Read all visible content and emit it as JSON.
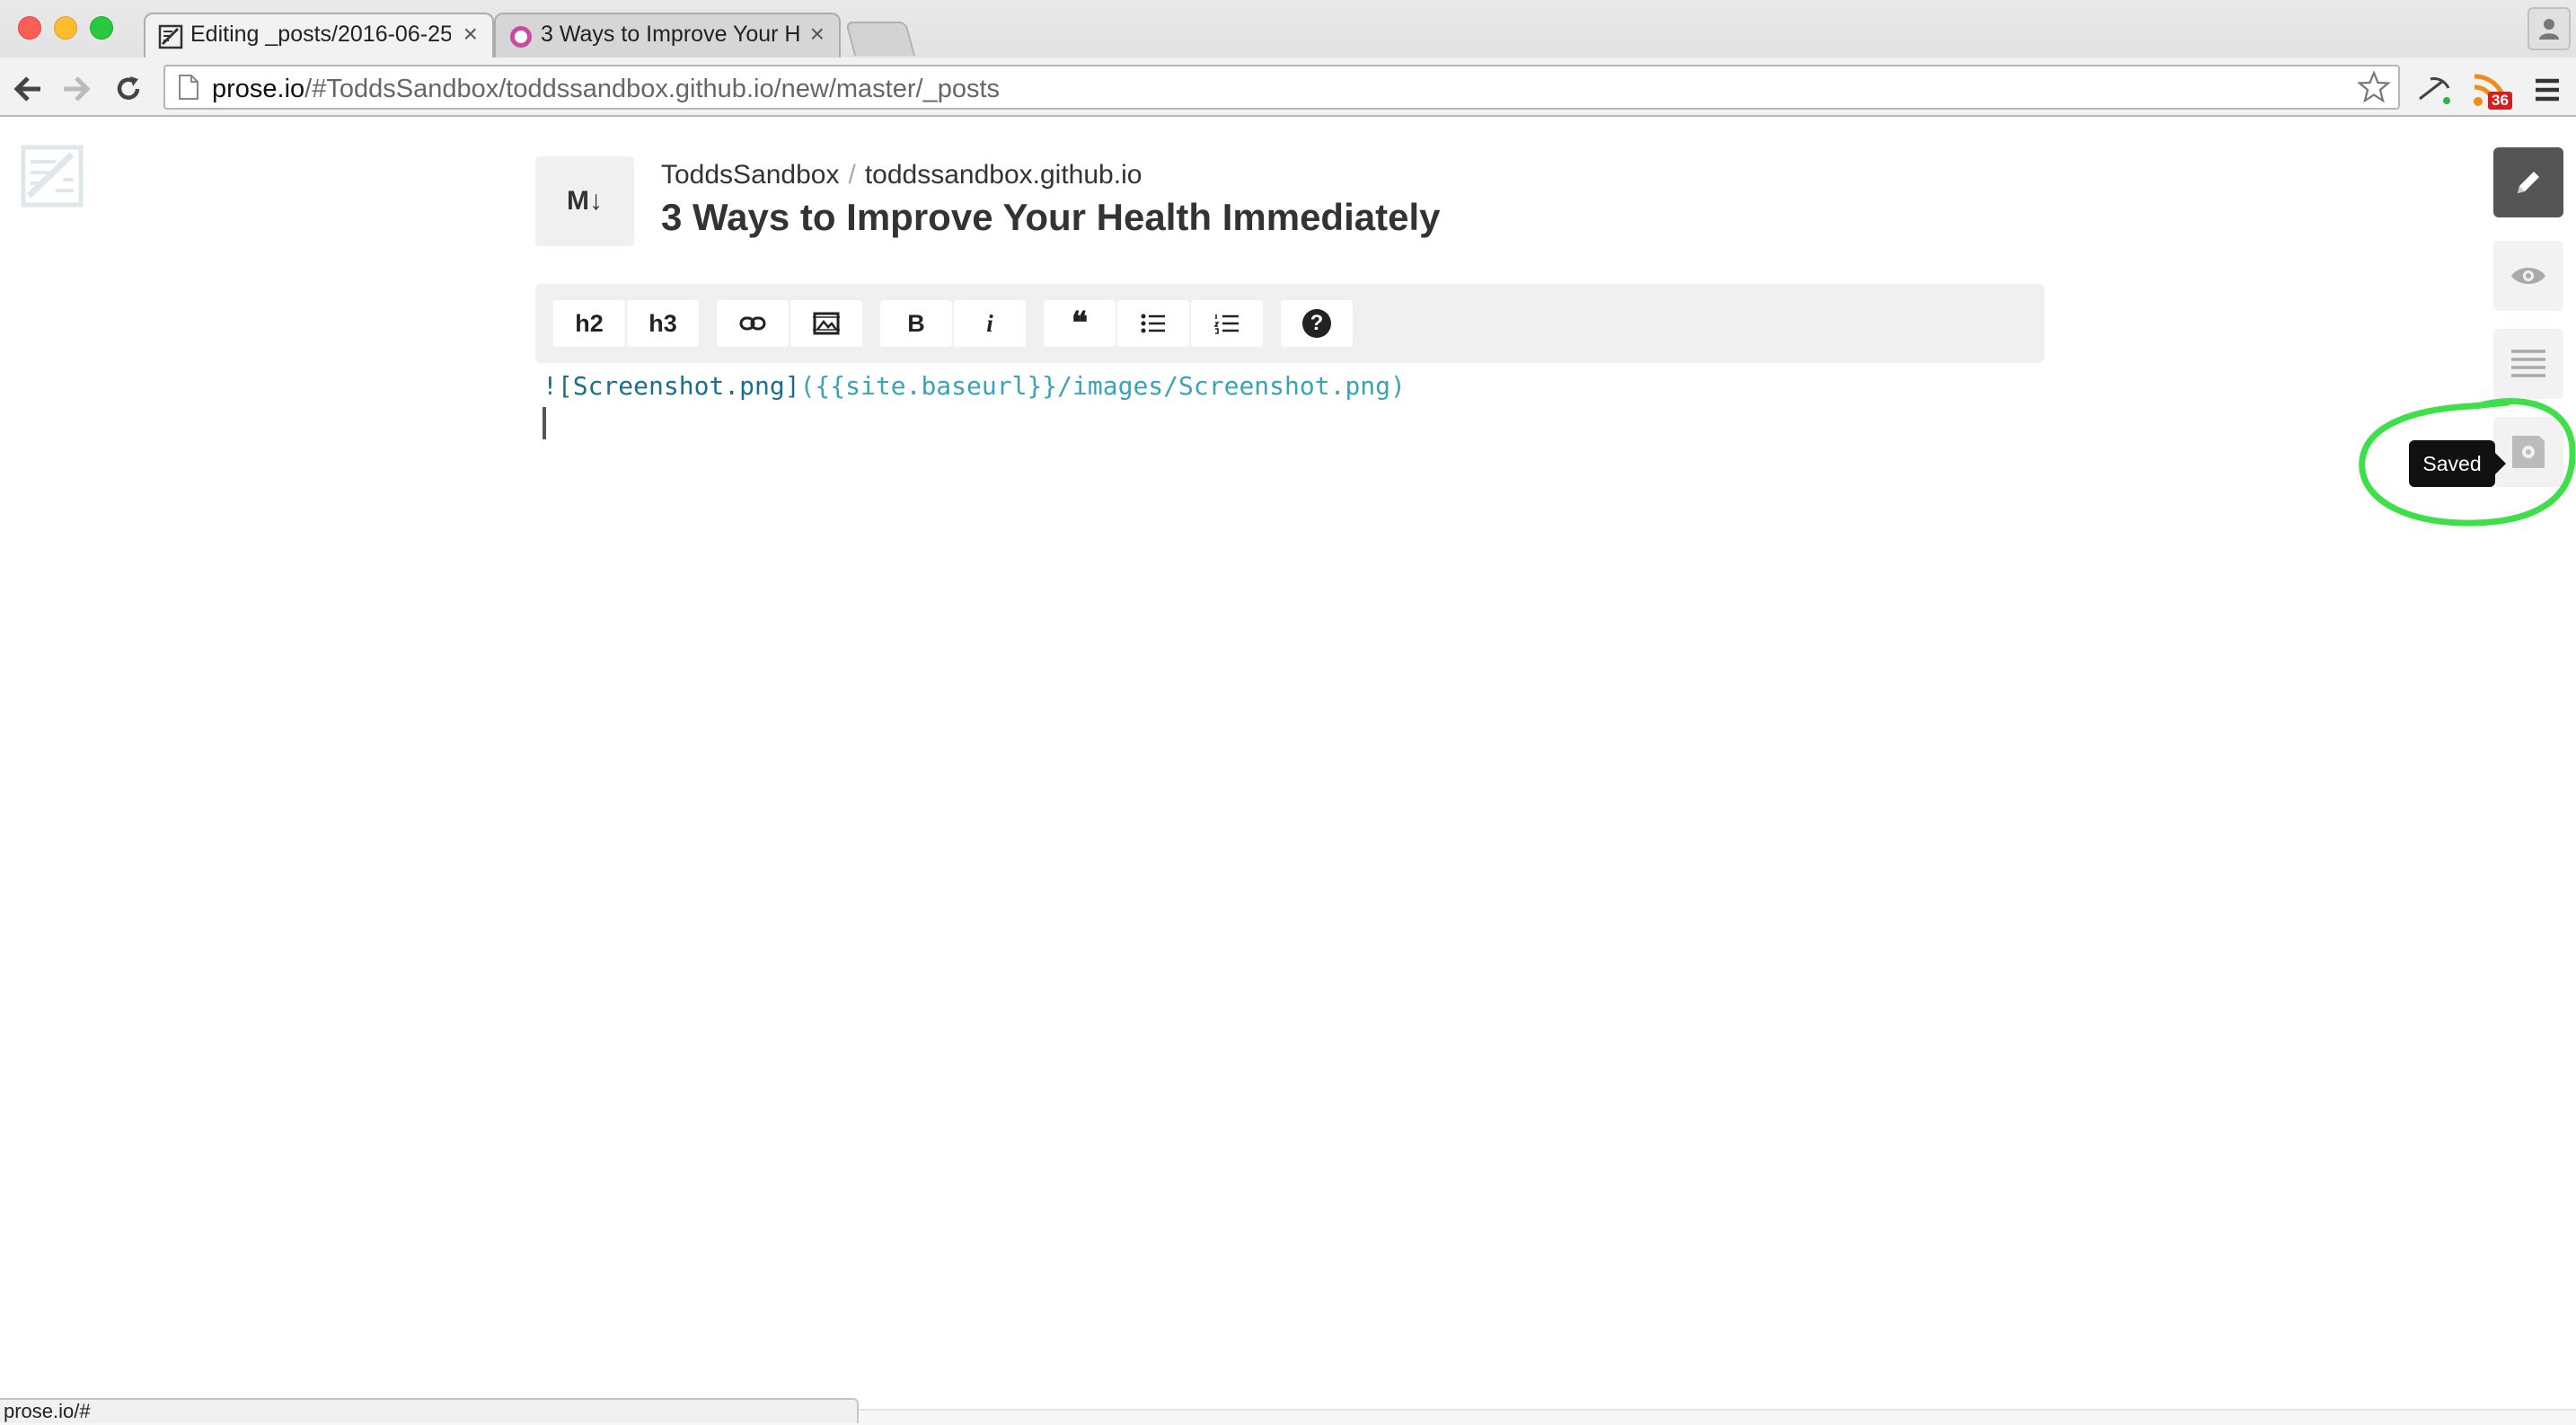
{
  "browser": {
    "tabs": [
      {
        "title": "Editing _posts/2016-06-25",
        "active": true,
        "close": "×"
      },
      {
        "title": "3 Ways to Improve Your Health Immediately",
        "active": false,
        "close": "×"
      }
    ],
    "url_host": "prose.io",
    "url_path": "/#ToddsSandbox/toddssandbox.github.io/new/master/_posts",
    "rss_badge": "36",
    "status_text": "prose.io/#"
  },
  "app": {
    "md_badge": "M↓",
    "breadcrumb": {
      "user": "ToddsSandbox",
      "separator": "/",
      "repo": "toddssandbox.github.io"
    },
    "post_title": "3 Ways to Improve Your Health Immediately",
    "toolbar": {
      "h2": "h2",
      "h3": "h3",
      "bold": "B",
      "italic": "i",
      "quote": "❝",
      "help": "?"
    },
    "editor": {
      "line1_bang": "!",
      "line1_alt": "[Screenshot.png]",
      "line1_url": "({{site.baseurl}}/images/Screenshot.png)"
    },
    "tooltip": "Saved"
  },
  "colors": {
    "annotation": "#3ee04a",
    "rail_active": "#555555",
    "link_text": "#1a6e8e"
  }
}
